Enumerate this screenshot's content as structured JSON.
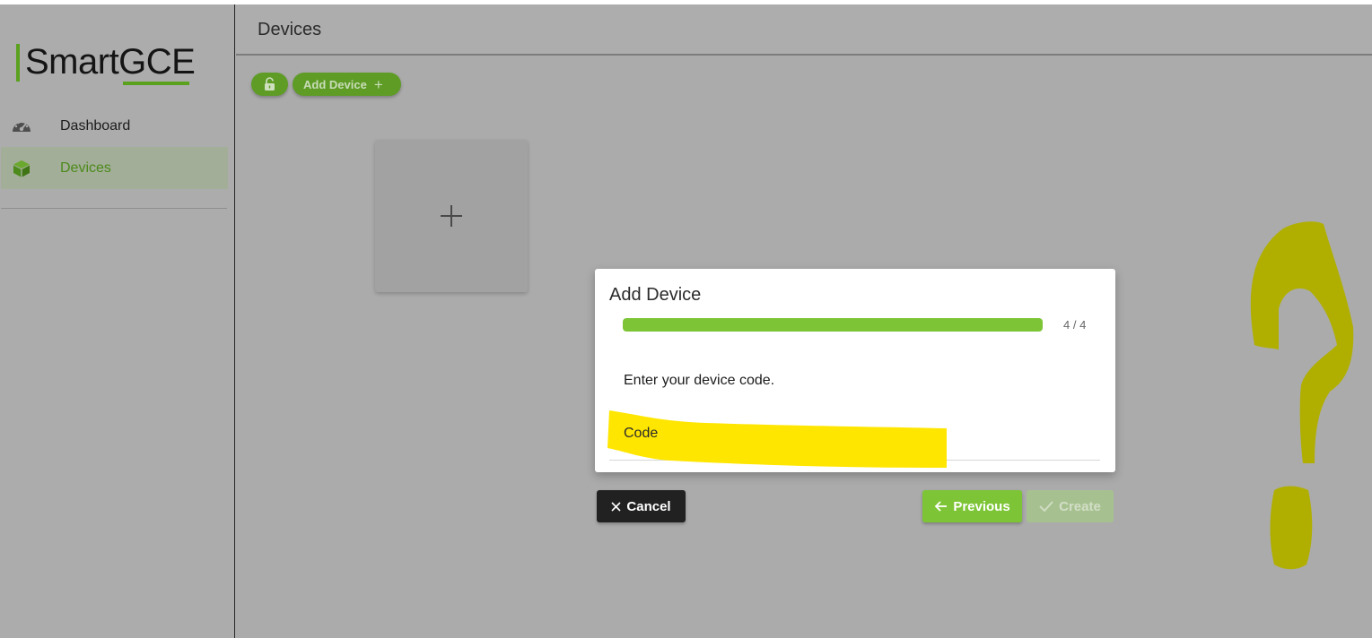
{
  "app": {
    "logo_text": "SmartGCE"
  },
  "sidebar": {
    "items": [
      {
        "label": "Dashboard",
        "icon": "speedometer-icon",
        "active": false
      },
      {
        "label": "Devices",
        "icon": "cube-icon",
        "active": true
      }
    ]
  },
  "header": {
    "title": "Devices"
  },
  "toolbar": {
    "lock_icon": "lock-open-icon",
    "add_device_label": "Add Device",
    "add_device_icon": "plus-icon"
  },
  "add_card": {
    "icon": "plus-icon"
  },
  "dialog": {
    "title": "Add Device",
    "progress": {
      "current": 4,
      "total": 4,
      "text": "4 / 4",
      "fraction": 1.0
    },
    "instruction": "Enter your device code.",
    "code_field": {
      "label": "Code",
      "value": ""
    },
    "buttons": {
      "cancel": "Cancel",
      "previous": "Previous",
      "create": "Create"
    }
  },
  "colors": {
    "accent_green": "#7dc536",
    "dark_green": "#5e9c26",
    "logo_green": "#5aa11e",
    "overlay_gray": "#ababab",
    "cancel_dark": "#212121",
    "highlight_yellow": "#ffe600",
    "scribble_olive": "#b0af00"
  }
}
